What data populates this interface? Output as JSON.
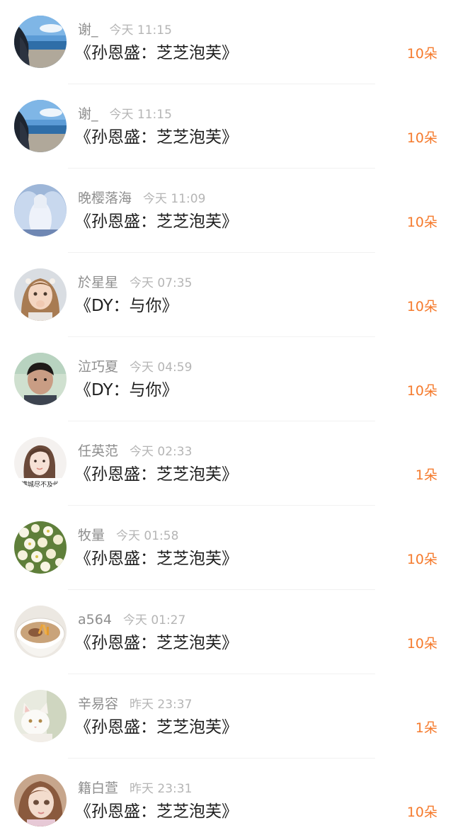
{
  "records": [
    {
      "avatar": "beach-girl-avatar",
      "username": "谢_",
      "time": "今天 11:15",
      "song": "《孙恩盛：芝芝泡芙》",
      "gift": "10朵"
    },
    {
      "avatar": "beach-girl-avatar",
      "username": "谢_",
      "time": "今天 11:15",
      "song": "《孙恩盛：芝芝泡芙》",
      "gift": "10朵"
    },
    {
      "avatar": "fantasy-angel-avatar",
      "username": "晚樱落海",
      "time": "今天 11:09",
      "song": "《孙恩盛：芝芝泡芙》",
      "gift": "10朵"
    },
    {
      "avatar": "little-girl-avatar",
      "username": "於星星",
      "time": "今天 07:35",
      "song": "《DY：与你》",
      "gift": "10朵"
    },
    {
      "avatar": "boy-portrait-avatar",
      "username": "泣巧夏",
      "time": "今天 04:59",
      "song": "《DY：与你》",
      "gift": "10朵"
    },
    {
      "avatar": "woman-selfie-avatar",
      "username": "任英范",
      "time": "今天 02:33",
      "song": "《孙恩盛：芝芝泡芙》",
      "gift": "1朵",
      "avatar_caption": "满城尽不及他"
    },
    {
      "avatar": "white-flowers-avatar",
      "username": "牧量",
      "time": "今天 01:58",
      "song": "《孙恩盛：芝芝泡芙》",
      "gift": "10朵"
    },
    {
      "avatar": "soup-bowl-avatar",
      "username": "a564",
      "time": "今天 01:27",
      "song": "《孙恩盛：芝芝泡芙》",
      "gift": "10朵"
    },
    {
      "avatar": "white-cat-avatar",
      "username": "辛易容",
      "time": "昨天 23:37",
      "song": "《孙恩盛：芝芝泡芙》",
      "gift": "1朵"
    },
    {
      "avatar": "doll-portrait-avatar",
      "username": "籍白萱",
      "time": "昨天 23:31",
      "song": "《孙恩盛：芝芝泡芙》",
      "gift": "10朵"
    }
  ],
  "colors": {
    "gift": "#f57a2c",
    "username": "#8e8e8e",
    "time": "#b5b5b5",
    "song": "#1f1f1f",
    "divider": "#f1f1f1"
  }
}
